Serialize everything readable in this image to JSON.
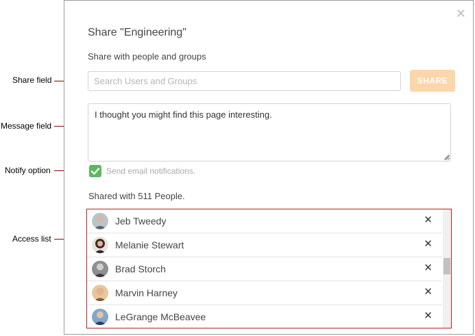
{
  "dialog": {
    "title": "Share \"Engineering\"",
    "subtitle": "Share with people and groups",
    "close_icon": "close-icon",
    "search": {
      "placeholder": "Search Users and Groups",
      "value": ""
    },
    "share_button": "SHARE",
    "message": "I thought you might find this page interesting.",
    "notify_label": "Send email notifications.",
    "notify_checked": true,
    "shared_count_text": "Shared with 511 People."
  },
  "access_list": {
    "users": [
      {
        "name": "Jeb Tweedy"
      },
      {
        "name": "Melanie Stewart"
      },
      {
        "name": "Brad Storch"
      },
      {
        "name": "Marvin Harney"
      },
      {
        "name": "LeGrange McBeavee"
      }
    ],
    "remove_glyph": "✕"
  },
  "callouts": {
    "share_field": "Share field",
    "message_field": "Message field",
    "notify_option": "Notify option",
    "access_list": "Access list"
  },
  "colors": {
    "share_button_bg": "#fbd6aa",
    "checkbox_green": "#5cb85c",
    "callout_line": "#8b0000",
    "highlight_border": "#b22222"
  }
}
